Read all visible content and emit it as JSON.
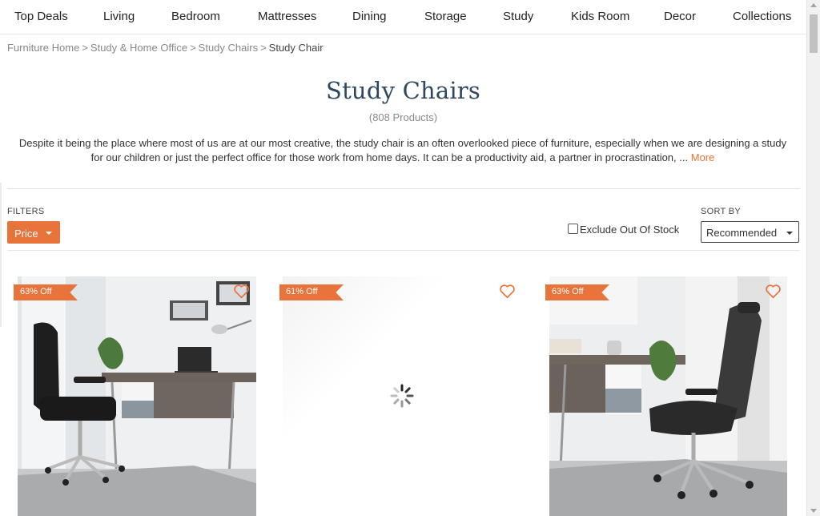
{
  "nav": {
    "items": [
      "Top Deals",
      "Living",
      "Bedroom",
      "Mattresses",
      "Dining",
      "Storage",
      "Study",
      "Kids Room",
      "Decor",
      "Collections"
    ]
  },
  "breadcrumb": {
    "items": [
      "Furniture Home",
      "Study & Home Office",
      "Study Chairs"
    ],
    "separator": ">",
    "current": "Study Chair"
  },
  "page": {
    "title": "Study Chairs",
    "count": "(808 Products)",
    "description": "Despite it being the place where most of us are at our most creative, the study chair is an often overlooked piece of furniture, especially when we are designing a study for our children or just the perfect office for those work from home days. It can be a productivity aid, a partner in procrastination, ...",
    "more_label": "More"
  },
  "filters": {
    "label": "FILTERS",
    "price_button": "Price",
    "exclude_out_of_stock": "Exclude Out Of Stock",
    "exclude_checked": false
  },
  "sort": {
    "label": "SORT BY",
    "selected": "Recommended"
  },
  "products": [
    {
      "badge": "63% Off",
      "image": "study-chair-black-mesh-desk-scene",
      "wishlisted": false
    },
    {
      "badge": "61% Off",
      "image": "loading-spinner",
      "wishlisted": false
    },
    {
      "badge": "63% Off",
      "image": "study-chair-grey-mesh-desk-scene",
      "wishlisted": false
    }
  ],
  "colors": {
    "accent": "#e8743b",
    "title": "#2e4660"
  }
}
